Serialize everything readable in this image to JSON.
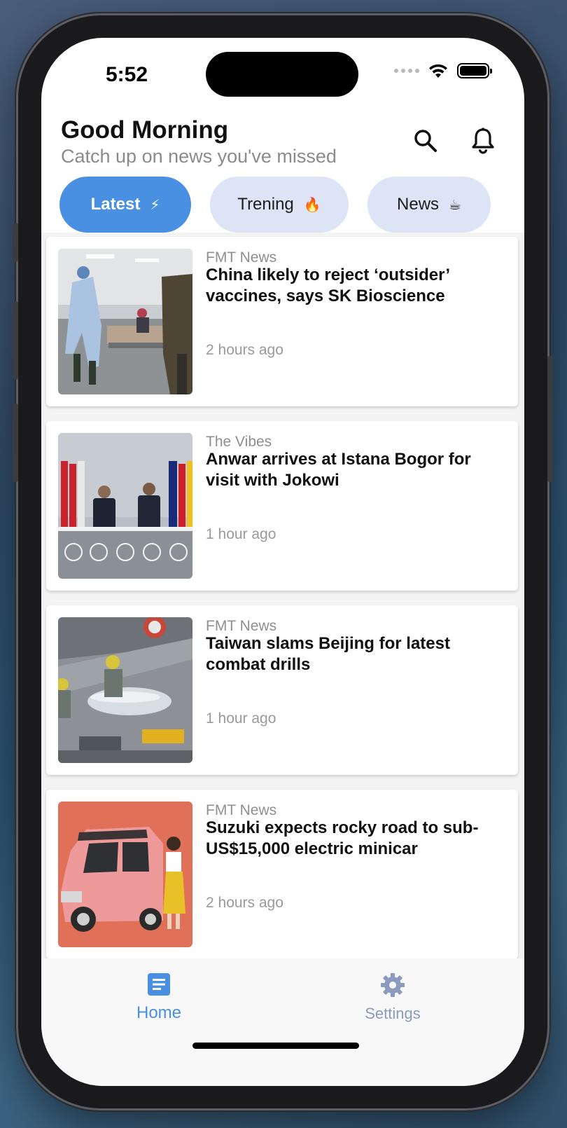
{
  "status": {
    "time": "5:52"
  },
  "header": {
    "greeting": "Good Morning",
    "subtitle": "Catch up on news you've missed",
    "icons": [
      "search-icon",
      "bell-icon"
    ]
  },
  "tabs": [
    {
      "label": "Latest",
      "emoji": "⚡",
      "active": true
    },
    {
      "label": "Trening",
      "emoji": "🔥",
      "active": false
    },
    {
      "label": "News",
      "emoji": "☕",
      "active": false
    }
  ],
  "articles": [
    {
      "source": "FMT News",
      "title": "China likely to reject ‘outsider’ vaccines, says SK Bioscience",
      "time": "2 hours ago",
      "image": "hospital-photo"
    },
    {
      "source": "The Vibes",
      "title": "Anwar arrives at Istana Bogor for visit with Jokowi",
      "time": "1 hour ago",
      "image": "leaders-balcony-photo"
    },
    {
      "source": "FMT News",
      "title": "Taiwan slams Beijing for latest combat drills",
      "time": "1 hour ago",
      "image": "missile-hangar-photo"
    },
    {
      "source": "FMT News",
      "title": "Suzuki expects rocky road to sub-US$15,000 electric minicar",
      "time": "2 hours ago",
      "image": "pink-minicar-photo"
    }
  ],
  "nav": {
    "home_label": "Home",
    "settings_label": "Settings"
  },
  "colors": {
    "accent": "#4a90e2",
    "chip_inactive": "#dde4f6",
    "nav_inactive": "#8b9bbd"
  }
}
